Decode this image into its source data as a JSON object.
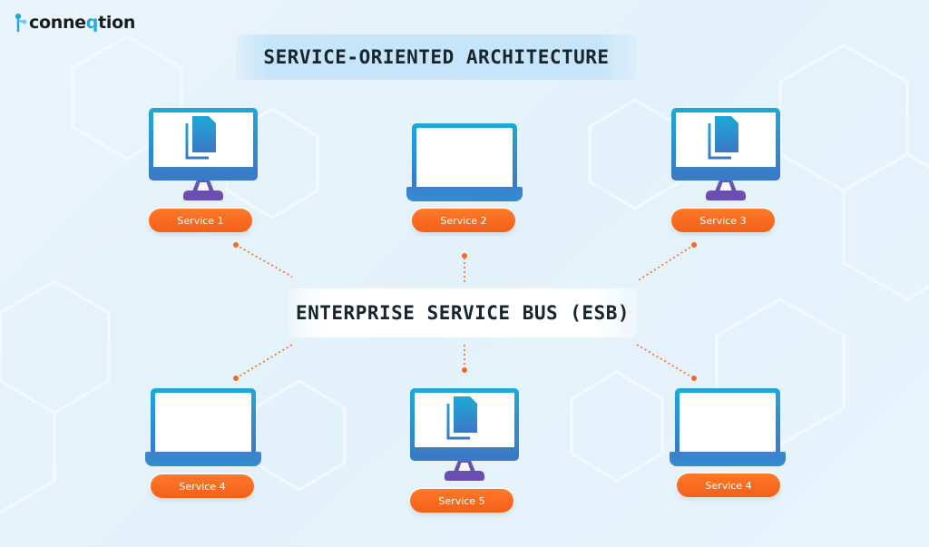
{
  "brand": {
    "logo_text_prefix": "conne",
    "logo_text_q": "q",
    "logo_text_suffix": "tion",
    "accent_color": "#2aa8d8"
  },
  "title": "SERVICE-ORIENTED ARCHITECTURE",
  "hub": {
    "label": "ENTERPRISE SERVICE BUS (ESB)"
  },
  "colors": {
    "pill": "#f2601a",
    "device_top": "#1ea9d6",
    "device_bottom": "#3b78c6",
    "stand": "#6a4fb0",
    "connector": "#f26a2a",
    "text_dark": "#17262e"
  },
  "services": [
    {
      "id": "s1",
      "label": "Service 1",
      "device": "monitor",
      "icon": "document-copy-icon",
      "position": "top-left"
    },
    {
      "id": "s2",
      "label": "Service 2",
      "device": "laptop",
      "icon": "",
      "position": "top-center"
    },
    {
      "id": "s3",
      "label": "Service 3",
      "device": "monitor",
      "icon": "document-copy-icon",
      "position": "top-right"
    },
    {
      "id": "s4a",
      "label": "Service 4",
      "device": "laptop",
      "icon": "",
      "position": "bottom-left"
    },
    {
      "id": "s5",
      "label": "Service 5",
      "device": "monitor",
      "icon": "document-copy-icon",
      "position": "bottom-center"
    },
    {
      "id": "s4b",
      "label": "Service 4",
      "device": "laptop",
      "icon": "",
      "position": "bottom-right"
    }
  ],
  "connections": [
    {
      "from": "s1",
      "to": "hub"
    },
    {
      "from": "s2",
      "to": "hub"
    },
    {
      "from": "s3",
      "to": "hub"
    },
    {
      "from": "s4a",
      "to": "hub"
    },
    {
      "from": "s5",
      "to": "hub"
    },
    {
      "from": "s4b",
      "to": "hub"
    }
  ]
}
